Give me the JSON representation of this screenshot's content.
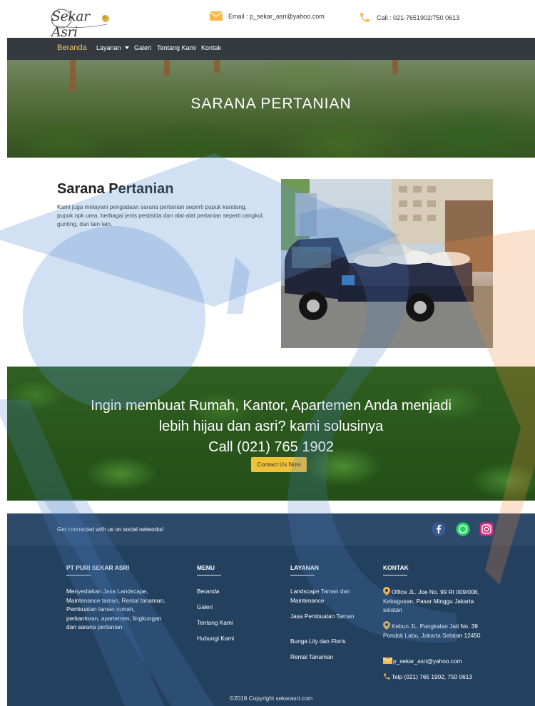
{
  "header": {
    "logo_text": "Sekar Asri",
    "email_text": "Email : p_sekar_asri@yahoo.com",
    "call_text": "Call : 021-7651902/750 0613"
  },
  "nav": {
    "items": [
      {
        "label": "Beranda",
        "active": true
      },
      {
        "label": "Layanan",
        "dropdown": true
      },
      {
        "label": "Galeri"
      },
      {
        "label": "Tentang Kami"
      },
      {
        "label": "Kontak"
      }
    ]
  },
  "hero": {
    "title": "SARANA PERTANIAN"
  },
  "section": {
    "title": "Sarana Pertanian",
    "description": "Kami juga melayani pengadaan sarana pertanian seperti pupuk kandang, pupuk npk urea, berbagai jenis pestisida dan alat-alat pertanian seperti cangkul, gunting, dan lain lain."
  },
  "cta": {
    "line1": "Ingin membuat Rumah, Kantor, Apartemen Anda menjadi",
    "line2": "lebih hijau dan asri? kami solusinya",
    "line3": "Call (021) 765 1902",
    "button_label": "Contact Us Now"
  },
  "social": {
    "text": "Get connected with us on social networks!",
    "icons": [
      "facebook-icon",
      "whatsapp-icon",
      "instagram-icon"
    ]
  },
  "footer": {
    "company": {
      "heading": "PT PURI SEKAR ASRI",
      "text": "Menyediakan Jasa Landscape, Maintenance taman, Rental tanaman, Pembuatan taman rumah, perkantoran, apartemen, lingkungan dan sarana pertanian."
    },
    "menu": {
      "heading": "MENU",
      "items": [
        "Beranda",
        "Galeri",
        "Tentang Kami",
        "Hubungi Kami"
      ]
    },
    "layanan": {
      "heading": "LAYANAN",
      "items": [
        "Landscape Taman dan Maintenance",
        "Jasa Pembuatan Taman",
        "Bunga Lily dan Floris",
        "Rental Tanaman"
      ]
    },
    "kontak": {
      "heading": "KONTAK",
      "office": "Office JL. Joe No. 99 Rt 009/008, Kebagusan, Pasar Minggu Jakarta selatan",
      "kebun": "Kebun JL. Pangkalan Jati No. 39 Pondok Labu, Jakarta Selatan 12450",
      "email": "p_sekar_asri@yahoo.com",
      "phone": "Telp (021) 765 1902, 750 0613"
    },
    "copyright": "©2019 Copyright sekarasri.com"
  },
  "colors": {
    "nav_bg": "#343a40",
    "accent": "#f0c239",
    "footer_bg": "#24405f",
    "social_bg": "#2d4a6b"
  }
}
